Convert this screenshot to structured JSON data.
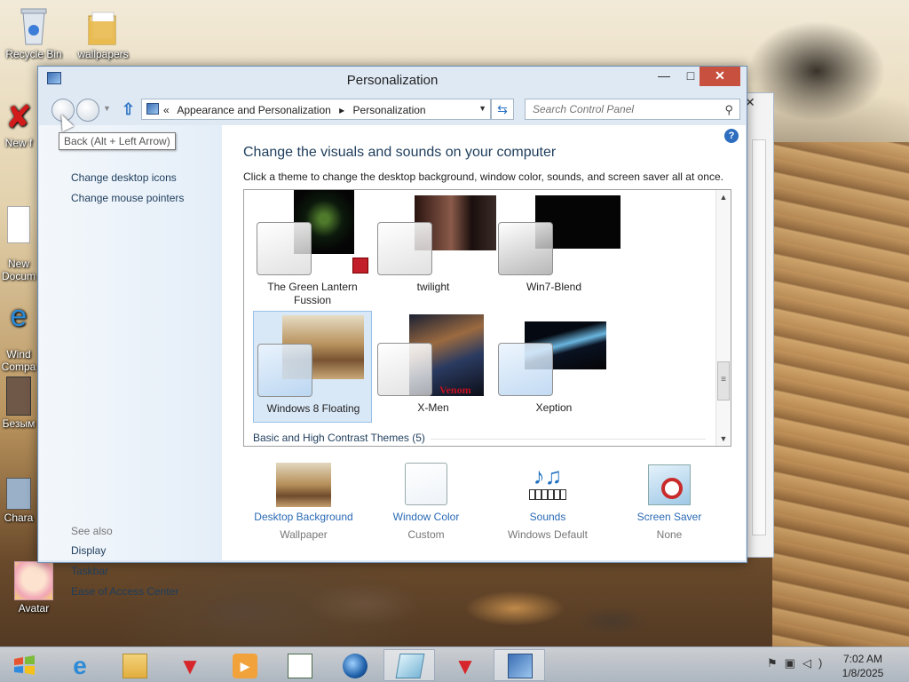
{
  "desktop": {
    "icons": [
      {
        "label": "Recycle Bin"
      },
      {
        "label": "wallpapers"
      },
      {
        "label": "New f"
      },
      {
        "label": "New\nDocum"
      },
      {
        "label": "Wind\nCompa"
      },
      {
        "label": "Безым"
      },
      {
        "label": "Chara"
      },
      {
        "label": "Avatar"
      }
    ]
  },
  "window": {
    "title": "Personalization",
    "controls": {
      "minimize": "—",
      "maximize": "□",
      "close": "✕"
    },
    "breadcrumb": {
      "overflow": "«",
      "items": [
        "Appearance and Personalization",
        "Personalization"
      ],
      "separator": "▸"
    },
    "search": {
      "placeholder": "Search Control Panel"
    },
    "tooltip": "Back (Alt + Left Arrow)",
    "sidebar": {
      "links": [
        "Change desktop icons",
        "Change mouse pointers"
      ],
      "see_also_label": "See also",
      "see_also": [
        "Display",
        "Taskbar",
        "Ease of Access Center"
      ]
    },
    "main": {
      "heading": "Change the visuals and sounds on your computer",
      "subheading": "Click a theme to change the desktop background, window color, sounds, and screen saver all at once.",
      "themes": [
        {
          "label": "The Green Lantern\nFussion",
          "selected": false
        },
        {
          "label": "twilight",
          "selected": false
        },
        {
          "label": "Win7-Blend",
          "selected": false
        },
        {
          "label": "Windows 8 Floating",
          "selected": true
        },
        {
          "label": "X-Men",
          "selected": false
        },
        {
          "label": "Xeption",
          "selected": false
        }
      ],
      "section": "Basic and High Contrast Themes (5)",
      "settings": [
        {
          "label": "Desktop Background",
          "value": "Wallpaper",
          "icon": "wallpaper-thumbnail-icon"
        },
        {
          "label": "Window Color",
          "value": "Custom",
          "icon": "window-color-icon"
        },
        {
          "label": "Sounds",
          "value": "Windows Default",
          "icon": "sounds-icon"
        },
        {
          "label": "Screen Saver",
          "value": "None",
          "icon": "screen-saver-icon"
        }
      ]
    }
  },
  "taskbar": {
    "clock": {
      "time": "7:02 AM",
      "date": "1/8/2025"
    },
    "apps": [
      "internet-explorer",
      "file-explorer",
      "app-red-1",
      "media-player",
      "app-window",
      "browser-globe",
      "app-notes",
      "app-red-2",
      "control-panel"
    ]
  },
  "colors": {
    "accent": "#2a6ab5",
    "close": "#c7503f",
    "selection": "#d9e8f7"
  }
}
